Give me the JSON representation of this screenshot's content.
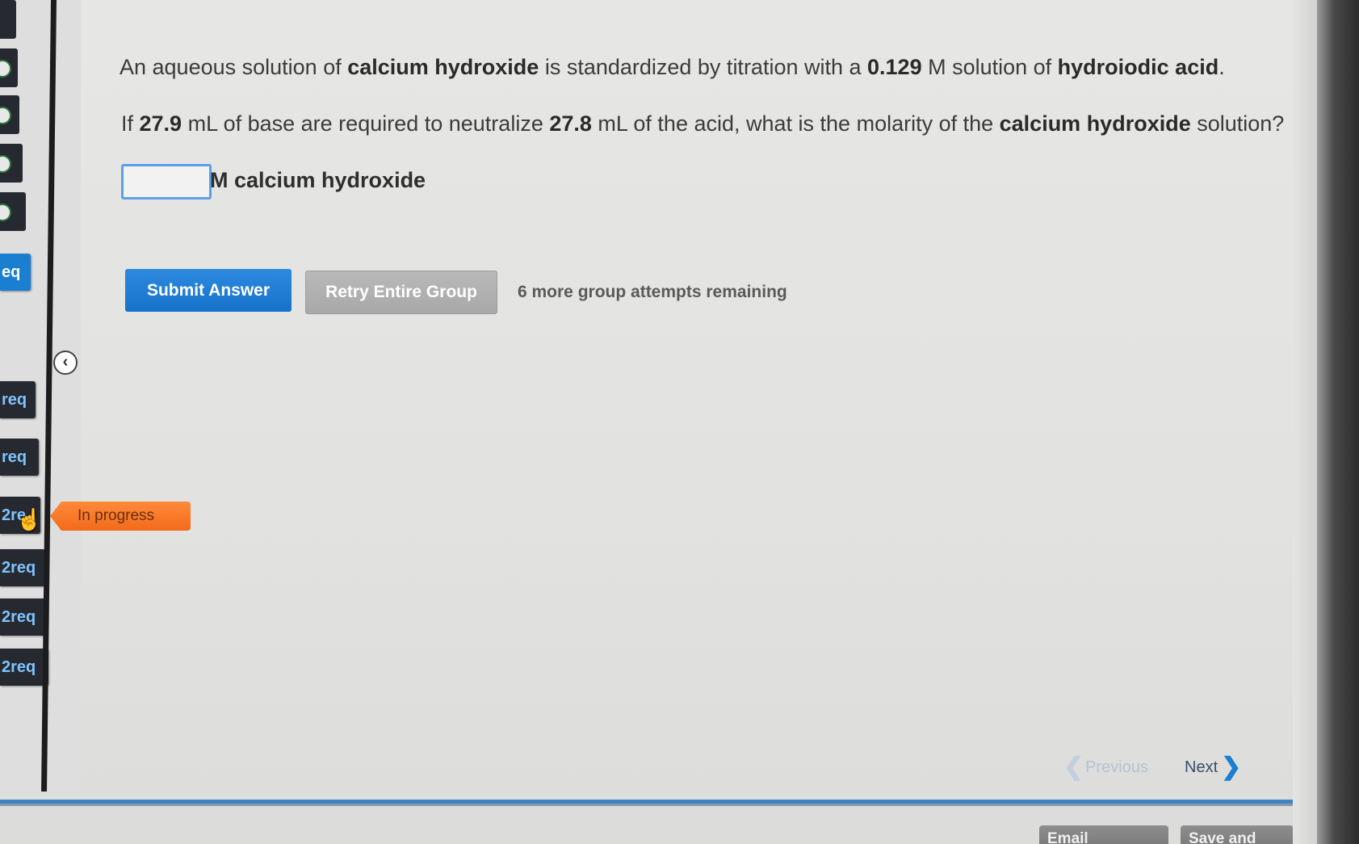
{
  "question": {
    "line1": {
      "t1": "An aqueous solution of ",
      "b1": "calcium hydroxide",
      "t2": " is standardized by titration with a ",
      "b2": "0.129",
      "t3": " M solution of ",
      "b3": "hydroiodic acid",
      "t4": "."
    },
    "line2": {
      "t1": "If ",
      "b1": "27.9",
      "t2": " mL of base are required to neutralize ",
      "b2": "27.8",
      "t3": " mL of the acid, what is the molarity of the ",
      "b3": "calcium hydroxide",
      "t4": " solution?"
    }
  },
  "answer": {
    "value": "",
    "unit_label": "M calcium hydroxide"
  },
  "actions": {
    "submit_label": "Submit Answer",
    "retry_label": "Retry Entire Group",
    "attempts_text": "6 more group attempts remaining"
  },
  "sidebar": {
    "tabs": [
      {
        "label": "eq",
        "active": true
      },
      {
        "label": "req"
      },
      {
        "label": "req"
      },
      {
        "label": "2re"
      },
      {
        "label": "2req"
      },
      {
        "label": "2req"
      },
      {
        "label": "2req"
      }
    ],
    "status_badge": "In progress",
    "collapse_icon": "chevron-left-icon"
  },
  "navigation": {
    "previous_label": "Previous",
    "next_label": "Next"
  },
  "footer": {
    "email_label": "Email Instructor",
    "save_label": "Save and Exit"
  },
  "colors": {
    "accent": "#1a7fd1",
    "status_orange": "#f26a1b",
    "retry_gray": "#b0b0b0"
  }
}
